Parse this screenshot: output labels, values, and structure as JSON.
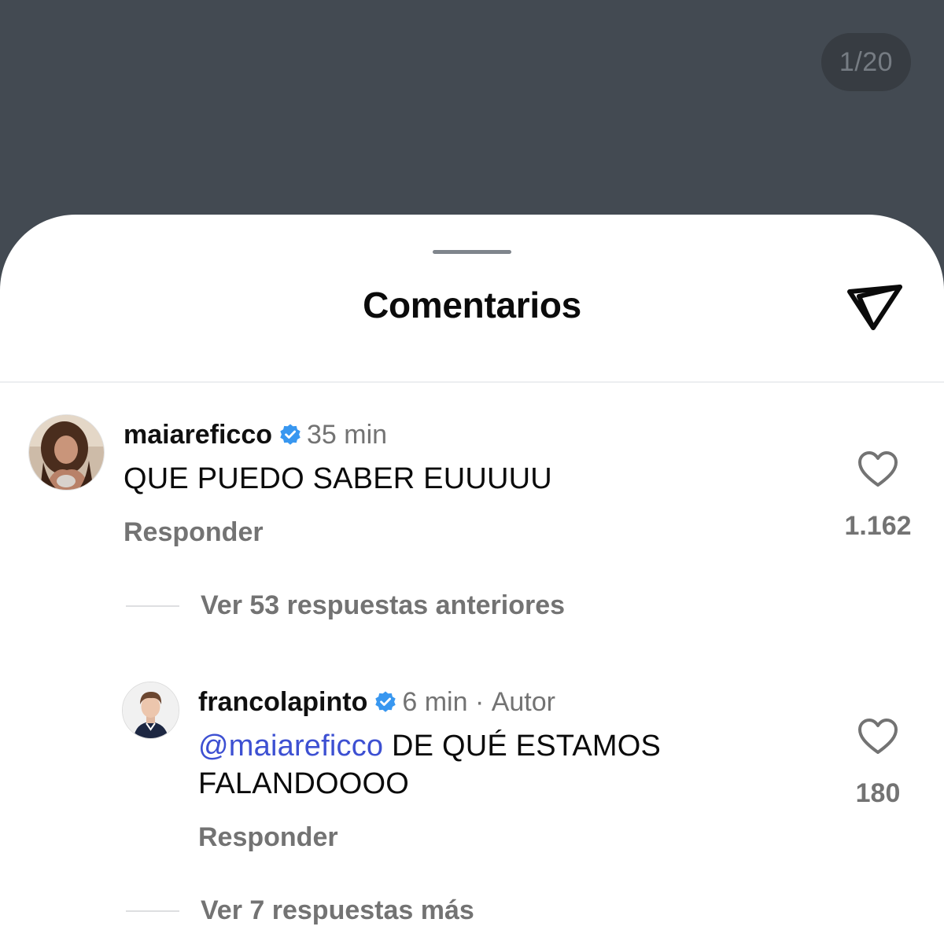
{
  "page_indicator": "1/20",
  "sheet": {
    "title": "Comentarios"
  },
  "icons": {
    "share": "paper-plane-icon",
    "verified": "verified-badge-icon",
    "like": "heart-outline-icon"
  },
  "colors": {
    "backdrop": "#434a52",
    "verified_badge": "#3897f0",
    "mention": "#3d50d2",
    "secondary_text": "#737373"
  },
  "comments": [
    {
      "username": "maiareficco",
      "verified": true,
      "time": "35 min",
      "text": "QUE PUEDO SABER EUUUUU",
      "reply_label": "Responder",
      "likes": "1.162",
      "view_replies_label": "Ver 53 respuestas anteriores"
    },
    {
      "username": "francolapinto",
      "verified": true,
      "time": "6 min",
      "meta_separator": "·",
      "author_label": "Autor",
      "mention": "@maiareficco",
      "text_line1": " DE QUÉ ESTAMOS",
      "text_line2": "FALANDOOOO",
      "reply_label": "Responder",
      "likes": "180",
      "view_replies_label": "Ver 7 respuestas más"
    }
  ]
}
